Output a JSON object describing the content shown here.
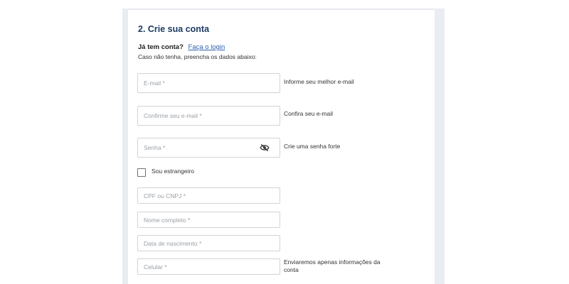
{
  "section": {
    "title": "2. Crie sua conta"
  },
  "login_prompt": {
    "question": "Já tem conta?",
    "link": "Faça o login",
    "instructions": "Caso não tenha, preencha os dados abaixo:"
  },
  "fields": {
    "email": {
      "placeholder": "E-mail *",
      "hint": "Informe seu melhor e-mail"
    },
    "confirm_email": {
      "placeholder": "Confirme seu e-mail *",
      "hint": "Confira seu e-mail"
    },
    "password": {
      "placeholder": "Senha *",
      "hint": "Crie uma senha forte",
      "toggle_icon": "eye-off-icon"
    },
    "cpf_cnpj": {
      "placeholder": "CPF ou CNPJ *"
    },
    "full_name": {
      "placeholder": "Nome completo *"
    },
    "birth_date": {
      "placeholder": "Data de nascimento *"
    },
    "phone": {
      "placeholder": "Celular *",
      "hint": "Enviaremos apenas informações da conta"
    }
  },
  "foreigner": {
    "label": "Sou estrangeiro",
    "checked": false
  },
  "colors": {
    "title": "#1b3b63",
    "link": "#2c5fb0",
    "border": "#cfd3d9",
    "gutter": "#e9ecf1"
  }
}
